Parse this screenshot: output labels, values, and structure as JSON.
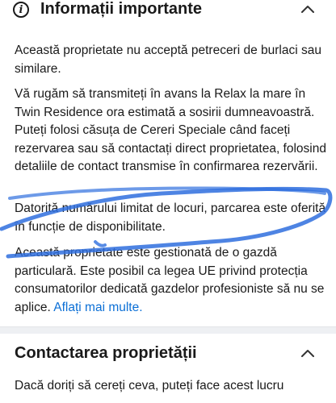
{
  "sections": [
    {
      "title": "Informații importante",
      "icon": "info-icon",
      "paragraphs": {
        "p1": "Această proprietate nu acceptă petreceri de burlaci sau similare.",
        "p2": "Vă rugăm să transmiteți în avans la Relax la mare în Twin Residence ora estimată a sosirii dumneavoastră. Puteți folosi căsuța de Cereri Speciale când faceți rezervarea sau să contactați direct proprietatea, folosind detaliile de contact transmise în confirmarea rezervării.",
        "p3": "Datorită numărului limitat de locuri, parcarea este oferită în funcție de disponibilitate.",
        "p4": "Această proprietate este gestionată de o gazdă particulară. Este posibil ca legea UE privind protecția consumatorilor dedicată gazdelor profesioniste să nu se aplice."
      },
      "link": "Aflați mai multe."
    },
    {
      "title": "Contactarea proprietății",
      "paragraph": "Dacă doriți să cereți ceva, puteți face acest lucru"
    }
  ],
  "colors": {
    "link": "#0b6fd6",
    "annotation": "#2f6fde"
  }
}
